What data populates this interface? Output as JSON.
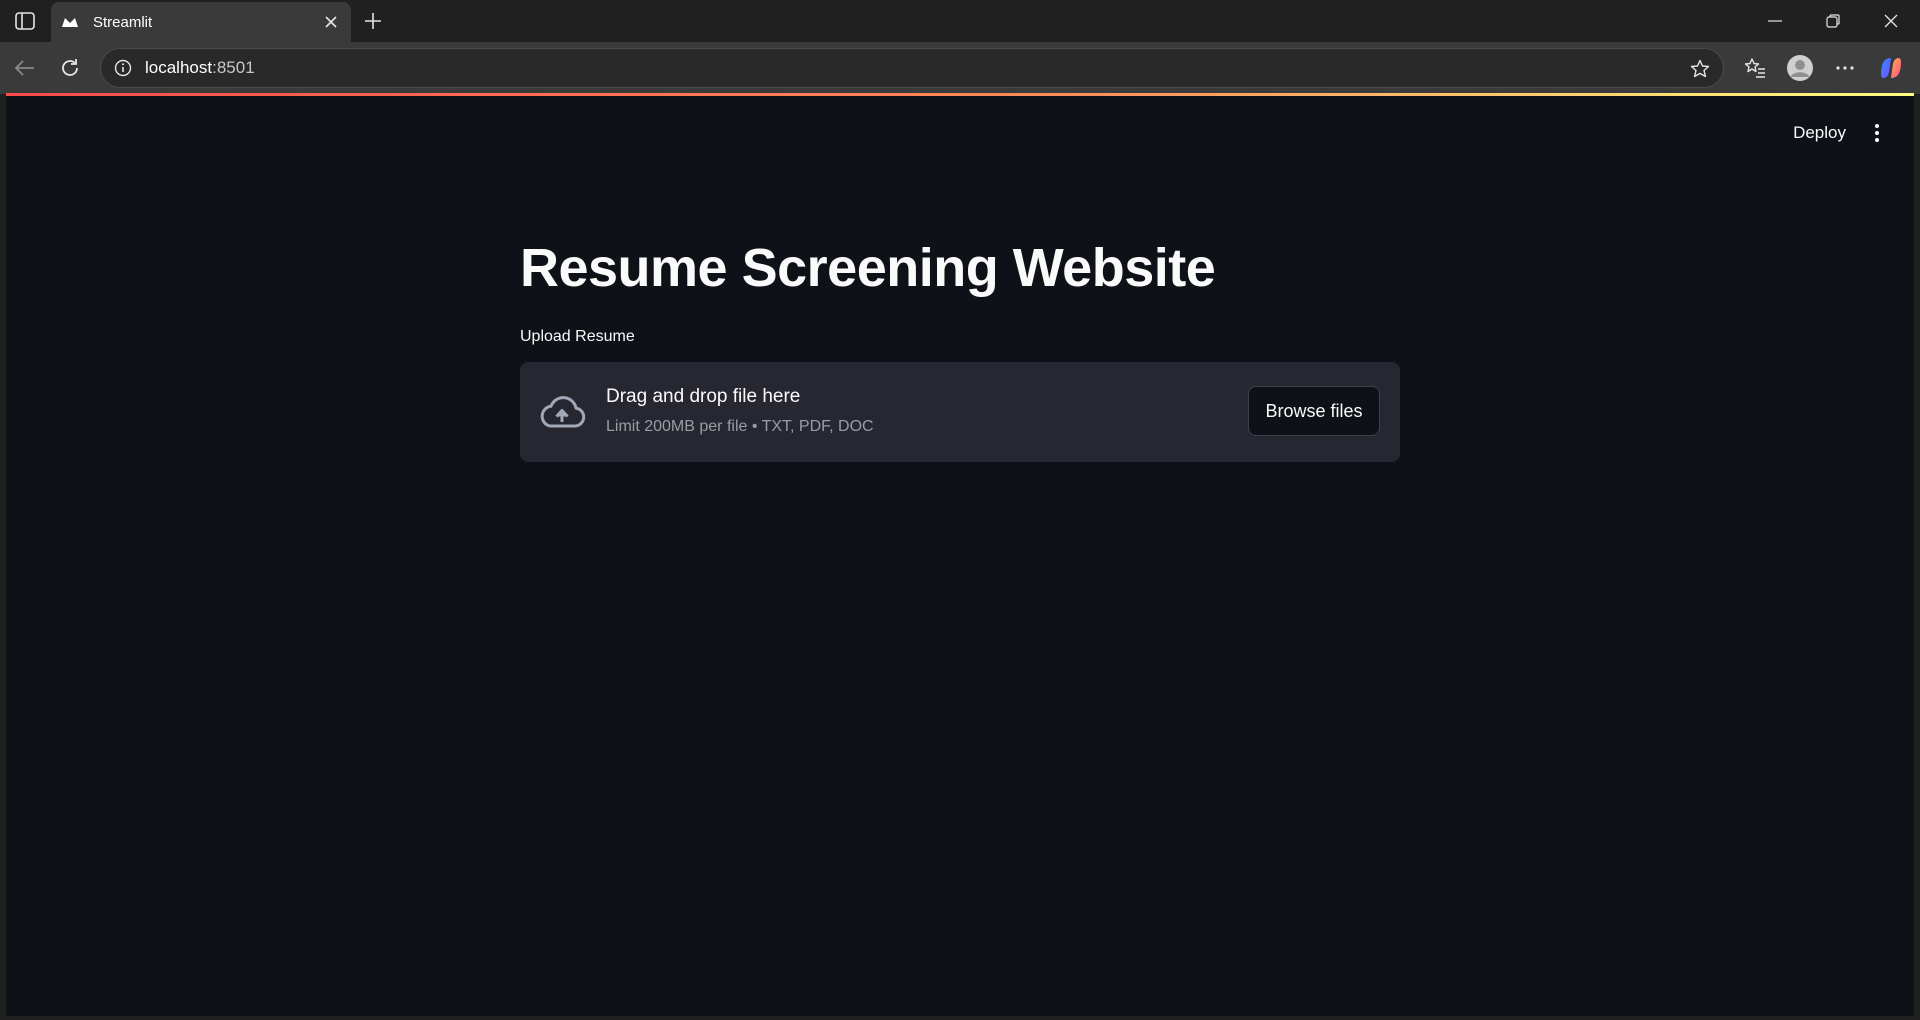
{
  "browser": {
    "tab_title": "Streamlit",
    "url_host": "localhost",
    "url_port": ":8501"
  },
  "app": {
    "deploy_label": "Deploy",
    "title": "Resume Screening Website",
    "uploader": {
      "label": "Upload Resume",
      "dropzone_title": "Drag and drop file here",
      "dropzone_subtitle": "Limit 200MB per file • TXT, PDF, DOC",
      "browse_label": "Browse files"
    }
  },
  "colors": {
    "app_background": "#0e1117",
    "dropzone_background": "#262730",
    "accent_gradient_start": "#ff4b4b",
    "accent_gradient_end": "#fffd80"
  },
  "icons": [
    "sidebar-toggle-icon",
    "streamlit-favicon-icon",
    "close-icon",
    "plus-icon",
    "minimize-icon",
    "restore-icon",
    "window-close-icon",
    "back-arrow-icon",
    "reload-icon",
    "info-icon",
    "star-icon",
    "favorites-icon",
    "profile-icon",
    "more-icon",
    "copilot-icon",
    "kebab-menu-icon",
    "cloud-upload-icon"
  ]
}
